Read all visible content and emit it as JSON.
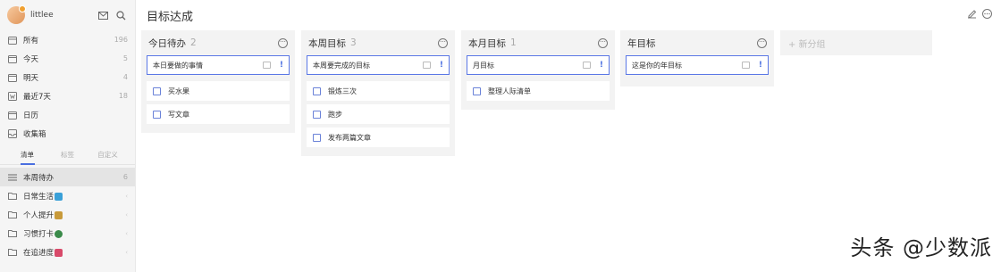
{
  "user": {
    "name": "littlee"
  },
  "nav": [
    {
      "label": "所有",
      "count": "196",
      "icon": "inbox-all-icon"
    },
    {
      "label": "今天",
      "count": "5",
      "icon": "calendar-today-icon"
    },
    {
      "label": "明天",
      "count": "4",
      "icon": "calendar-tomorrow-icon"
    },
    {
      "label": "最近7天",
      "count": "18",
      "icon": "calendar-week-icon"
    },
    {
      "label": "日历",
      "count": "",
      "icon": "calendar-icon"
    },
    {
      "label": "收集箱",
      "count": "",
      "icon": "inbox-icon"
    }
  ],
  "sidebar_tabs": [
    "清单",
    "标签",
    "自定义"
  ],
  "lists": [
    {
      "label": "本周待办",
      "count": "6",
      "active": true
    },
    {
      "label": "日常生活",
      "count": "",
      "emoji_color": "#3aa0d8"
    },
    {
      "label": "个人提升",
      "count": "",
      "emoji_color": "#c89a3a"
    },
    {
      "label": "习惯打卡",
      "count": "",
      "emoji_color": "#3a8a4a"
    },
    {
      "label": "在追进度",
      "count": "",
      "emoji_color": "#d84a6a"
    }
  ],
  "page": {
    "title": "目标达成"
  },
  "columns": [
    {
      "title": "今日待办",
      "count": "2",
      "input": "本日要做的事情",
      "tasks": [
        "买水果",
        "写文章"
      ]
    },
    {
      "title": "本周目标",
      "count": "3",
      "input": "本周要完成的目标",
      "tasks": [
        "锻炼三次",
        "跑步",
        "发布两篇文章"
      ]
    },
    {
      "title": "本月目标",
      "count": "1",
      "input": "月目标",
      "tasks": [
        "整理人际清单"
      ]
    },
    {
      "title": "年目标",
      "count": "",
      "input": "这是你的年目标",
      "tasks": []
    }
  ],
  "new_group": "+ 新分组",
  "watermark": "头条 @少数派",
  "colors": {
    "accent": "#4a6fe0",
    "column_bg": "#f3f3f3",
    "sidebar_bg": "#f5f5f5"
  }
}
